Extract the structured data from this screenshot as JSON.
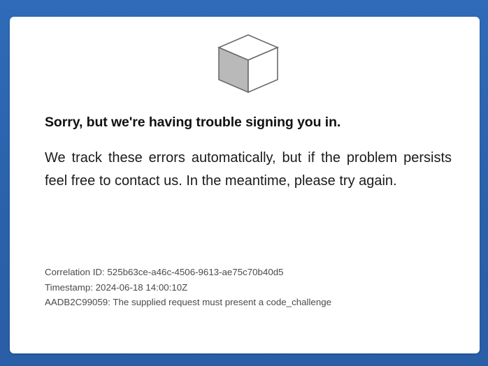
{
  "dialog": {
    "logo_icon": "cube-icon",
    "heading": "Sorry, but we're having trouble signing you in.",
    "message": "We track these errors automatically, but if the problem persists feel free to contact us. In the meantime, please try again.",
    "correlation": "Correlation ID: 525b63ce-a46c-4506-9613-ae75c70b40d5",
    "timestamp": "Timestamp: 2024-06-18 14:00:10Z",
    "error": "AADB2C99059: The supplied request must present a code_challenge"
  },
  "colors": {
    "background": "#2f6bb8",
    "card": "#ffffff",
    "heading": "#111111",
    "details": "#4a4a4a"
  }
}
